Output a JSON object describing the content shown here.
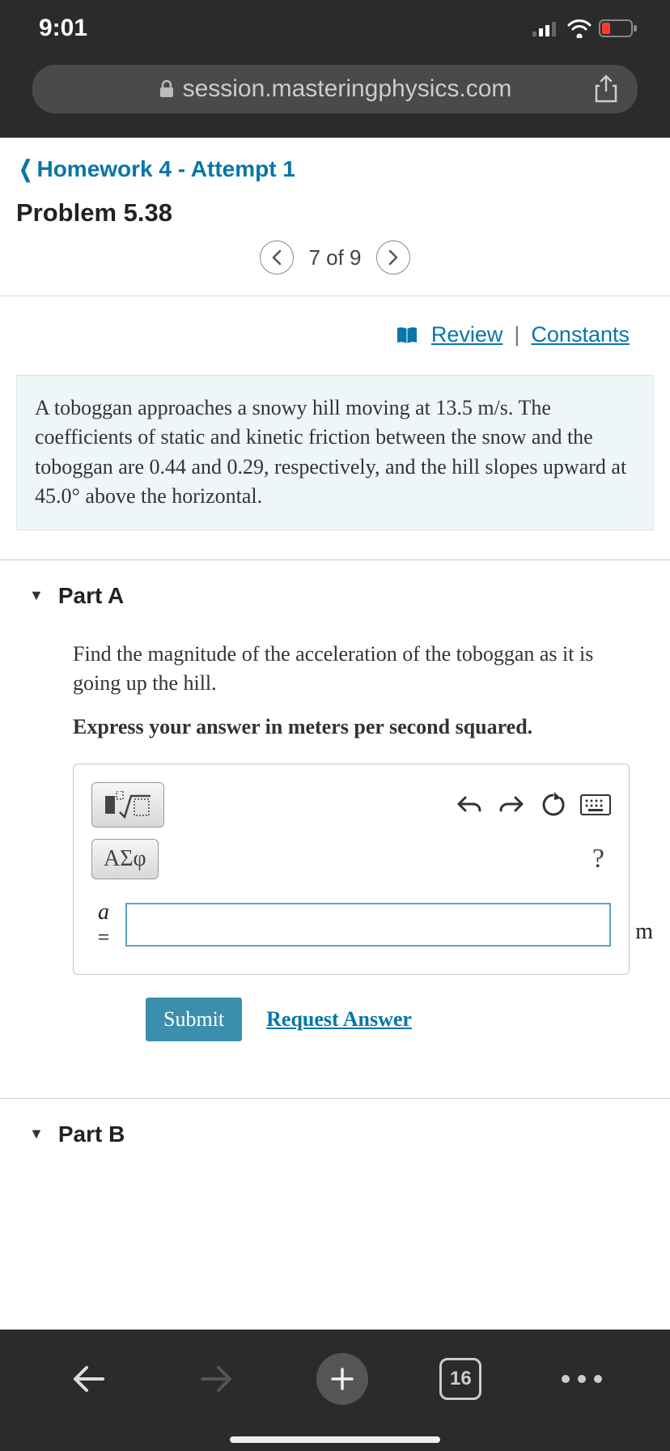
{
  "status": {
    "time": "9:01"
  },
  "browser": {
    "url": "session.masteringphysics.com",
    "tab_count": "16"
  },
  "breadcrumb": {
    "label": "Homework 4 - Attempt 1"
  },
  "page": {
    "title": "Problem 5.38"
  },
  "pager": {
    "position": "7 of 9"
  },
  "links": {
    "review": "Review",
    "sep": "|",
    "constants": "Constants"
  },
  "problem": {
    "text": "A toboggan approaches a snowy hill moving at 13.5 m/s. The coefficients of static and kinetic friction between the snow and the toboggan are 0.44 and 0.29, respectively, and the hill slopes upward at 45.0° above the horizontal."
  },
  "partA": {
    "header": "Part A",
    "prompt": "Find the magnitude of the acceleration of the toboggan as it is going up the hill.",
    "hint": "Express your answer in meters per second squared.",
    "greek_label": "ΑΣφ",
    "help": "?",
    "var": "a",
    "eq": "=",
    "unit": "m",
    "submit": "Submit",
    "request": "Request Answer"
  },
  "partB": {
    "header": "Part B"
  }
}
